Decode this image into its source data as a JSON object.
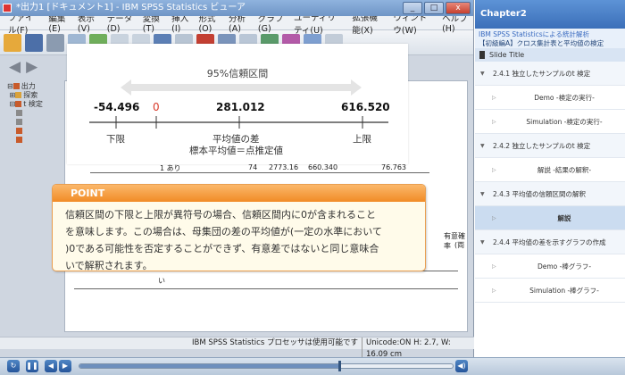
{
  "window": {
    "title": "*出力1 [ドキュメント1] - IBM SPSS Statistics ビューア",
    "controls": [
      "_",
      "□",
      "x"
    ]
  },
  "menu": [
    "ファイル(F)",
    "編集(E)",
    "表示(V)",
    "データ(D)",
    "変換(T)",
    "挿入(I)",
    "形式(O)",
    "分析(A)",
    "グラフ(G)",
    "ユーティリティ(U)",
    "拡張機能(X)",
    "ウィンドウ(W)",
    "ヘルプ(H)"
  ],
  "tree": {
    "output": "出力",
    "explore": "探索",
    "ttest": "t 検定"
  },
  "background": {
    "row_label": "1 あり",
    "row_n": "74",
    "row_mean": "2773.16",
    "row_sd": "660.340",
    "row_se": "76.763",
    "col_header": "有意確率",
    "col_sub": "(両",
    "t_label": "い"
  },
  "status": {
    "processor": "IBM SPSS Statistics プロセッサは使用可能です",
    "encoding": "Unicode:ON  H: 2.7, W: 16.09 cm"
  },
  "diagram": {
    "range_label": "95%信頼区間",
    "lower_value": "-54.496",
    "zero_value": "0",
    "mean_value": "281.012",
    "upper_value": "616.520",
    "lower_label": "下限",
    "mean_label": "平均値の差",
    "mean_sub_label": "標本平均値＝点推定値",
    "upper_label": "上限",
    "zero_color": "#d93b2b"
  },
  "point": {
    "heading": "POINT",
    "lines": [
      "信頼区間の下限と上限が異符号の場合、信頼区間内に0が含まれること",
      "を意味します。この場合は、母集団の差の平均値が(一定の水準において",
      ")0である可能性を否定することができず、有意差ではないと同じ意味合",
      "いで解釈されます。"
    ]
  },
  "player": {
    "progress": 0.695
  },
  "panel": {
    "chapter": "Chapter2",
    "course_title": "IBM SPSS Statisticsによる統計解析",
    "course_sub": "【初級編A】クロス集計表と平均値の検定",
    "slide_title": "Slide Title",
    "items": [
      {
        "text": "2.4.1 独立したサンプルのt 検定",
        "kind": "sec"
      },
      {
        "text": "Demo -検定の実行-",
        "kind": "sub"
      },
      {
        "text": "Simulation -検定の実行-",
        "kind": "sub"
      },
      {
        "text": "2.4.2 独立したサンプルのt 検定",
        "kind": "sec"
      },
      {
        "text": "解説 -結果の解釈-",
        "kind": "sub"
      },
      {
        "text": "2.4.3 平均値の信頼区間の解釈",
        "kind": "sec"
      },
      {
        "text": "解説",
        "kind": "active"
      },
      {
        "text": "2.4.4 平均値の差を示すグラフの作成",
        "kind": "sec"
      },
      {
        "text": "Demo -棒グラフ-",
        "kind": "sub"
      },
      {
        "text": "Simulation -棒グラフ-",
        "kind": "sub"
      }
    ]
  }
}
